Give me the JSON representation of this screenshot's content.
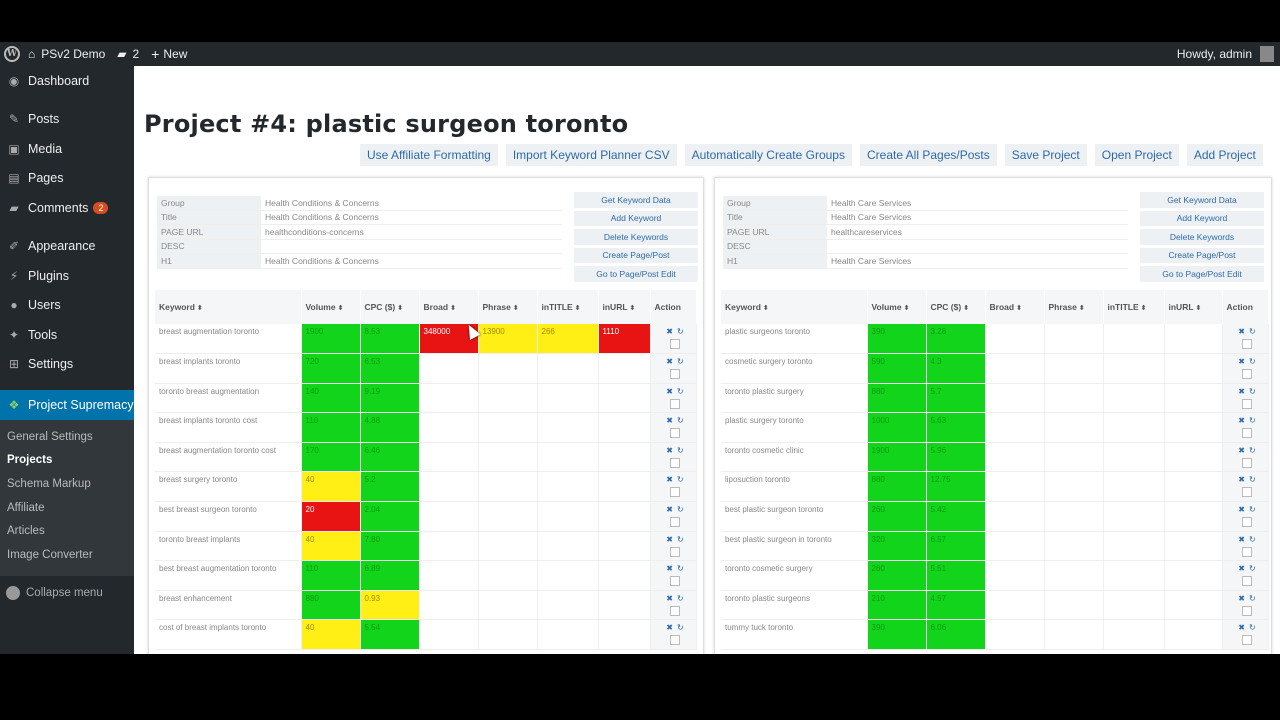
{
  "adminbar": {
    "site_name": "PSv2 Demo",
    "comments_count": "2",
    "new_label": "New",
    "howdy": "Howdy, admin"
  },
  "sidebar": {
    "items": [
      {
        "label": "Dashboard",
        "icon": "dashboard-icon"
      },
      {
        "label": "Posts",
        "icon": "pin-icon"
      },
      {
        "label": "Media",
        "icon": "media-icon"
      },
      {
        "label": "Pages",
        "icon": "pages-icon"
      },
      {
        "label": "Comments",
        "icon": "comment-icon",
        "badge": "2"
      },
      {
        "label": "Appearance",
        "icon": "brush-icon"
      },
      {
        "label": "Plugins",
        "icon": "plug-icon"
      },
      {
        "label": "Users",
        "icon": "user-icon"
      },
      {
        "label": "Tools",
        "icon": "wrench-icon"
      },
      {
        "label": "Settings",
        "icon": "settings-icon"
      },
      {
        "label": "Project Supremacy",
        "icon": "leaf-icon"
      }
    ],
    "submenu": [
      "General Settings",
      "Projects",
      "Schema Markup",
      "Affiliate",
      "Articles",
      "Image Converter"
    ],
    "collapse_label": "Collapse menu"
  },
  "page_title": "Project #4: plastic surgeon toronto",
  "toolbar": [
    "Use Affiliate Formatting",
    "Import Keyword Planner CSV",
    "Automatically Create Groups",
    "Create All Pages/Posts",
    "Save Project",
    "Open Project",
    "Add Project"
  ],
  "panel_actions": [
    "Get Keyword Data",
    "Add Keyword",
    "Delete Keywords",
    "Create Page/Post",
    "Go to Page/Post Edit"
  ],
  "columns": [
    "Keyword",
    "Volume",
    "CPC ($)",
    "Broad",
    "Phrase",
    "inTITLE",
    "inURL",
    "Action"
  ],
  "colors": {
    "green": "#12d41a",
    "yellow": "#ffef14",
    "red": "#e81313",
    "sidebar": "#23282d",
    "active": "#0073aa"
  },
  "groups": [
    {
      "meta": [
        {
          "key": "Group",
          "value": "Health Conditions & Concerns"
        },
        {
          "key": "Title",
          "value": "Health Conditions & Concerns"
        },
        {
          "key": "PAGE URL",
          "value": "healthconditions-concerns"
        },
        {
          "key": "DESC",
          "value": ""
        },
        {
          "key": "H1",
          "value": "Health Conditions & Concerns"
        }
      ],
      "rows": [
        {
          "keyword": "breast augmentation toronto",
          "volume": {
            "v": "1900",
            "c": "g"
          },
          "cpc": {
            "v": "8.53",
            "c": "g"
          },
          "broad": {
            "v": "348000",
            "c": "r"
          },
          "phrase": {
            "v": "13900",
            "c": "y"
          },
          "intitle": {
            "v": "266",
            "c": "y"
          },
          "inurl": {
            "v": "1110",
            "c": "r"
          }
        },
        {
          "keyword": "breast implants toronto",
          "volume": {
            "v": "720",
            "c": "g"
          },
          "cpc": {
            "v": "6.53",
            "c": "g"
          }
        },
        {
          "keyword": "toronto breast augmentation",
          "volume": {
            "v": "140",
            "c": "g"
          },
          "cpc": {
            "v": "9.19",
            "c": "g"
          }
        },
        {
          "keyword": "breast implants toronto cost",
          "volume": {
            "v": "110",
            "c": "g"
          },
          "cpc": {
            "v": "4.88",
            "c": "g"
          }
        },
        {
          "keyword": "breast augmentation toronto cost",
          "volume": {
            "v": "170",
            "c": "g"
          },
          "cpc": {
            "v": "6.46",
            "c": "g"
          }
        },
        {
          "keyword": "breast surgery toronto",
          "volume": {
            "v": "40",
            "c": "y"
          },
          "cpc": {
            "v": "5.2",
            "c": "g"
          }
        },
        {
          "keyword": "best breast surgeon toronto",
          "volume": {
            "v": "20",
            "c": "r"
          },
          "cpc": {
            "v": "2.04",
            "c": "g"
          }
        },
        {
          "keyword": "toronto breast implants",
          "volume": {
            "v": "40",
            "c": "y"
          },
          "cpc": {
            "v": "7.80",
            "c": "g"
          }
        },
        {
          "keyword": "best breast augmentation toronto",
          "volume": {
            "v": "110",
            "c": "g"
          },
          "cpc": {
            "v": "6.89",
            "c": "g"
          }
        },
        {
          "keyword": "breast enhancement",
          "volume": {
            "v": "880",
            "c": "g"
          },
          "cpc": {
            "v": "0.93",
            "c": "y"
          }
        },
        {
          "keyword": "cost of breast implants toronto",
          "volume": {
            "v": "40",
            "c": "y"
          },
          "cpc": {
            "v": "5.54",
            "c": "g"
          }
        }
      ]
    },
    {
      "meta": [
        {
          "key": "Group",
          "value": "Health Care Services"
        },
        {
          "key": "Title",
          "value": "Health Care Services"
        },
        {
          "key": "PAGE URL",
          "value": "healthcareservices"
        },
        {
          "key": "DESC",
          "value": ""
        },
        {
          "key": "H1",
          "value": "Health Care Services"
        }
      ],
      "rows": [
        {
          "keyword": "plastic surgeons toronto",
          "volume": {
            "v": "390",
            "c": "g"
          },
          "cpc": {
            "v": "3.28",
            "c": "g"
          }
        },
        {
          "keyword": "cosmetic surgery toronto",
          "volume": {
            "v": "590",
            "c": "g"
          },
          "cpc": {
            "v": "4.3",
            "c": "g"
          }
        },
        {
          "keyword": "toronto plastic surgery",
          "volume": {
            "v": "880",
            "c": "g"
          },
          "cpc": {
            "v": "5.7",
            "c": "g"
          }
        },
        {
          "keyword": "plastic surgery toronto",
          "volume": {
            "v": "1000",
            "c": "g"
          },
          "cpc": {
            "v": "5.63",
            "c": "g"
          }
        },
        {
          "keyword": "toronto cosmetic clinic",
          "volume": {
            "v": "1900",
            "c": "g"
          },
          "cpc": {
            "v": "5.96",
            "c": "g"
          }
        },
        {
          "keyword": "liposuction toronto",
          "volume": {
            "v": "880",
            "c": "g"
          },
          "cpc": {
            "v": "12.75",
            "c": "g"
          }
        },
        {
          "keyword": "best plastic surgeon toronto",
          "volume": {
            "v": "260",
            "c": "g"
          },
          "cpc": {
            "v": "5.42",
            "c": "g"
          }
        },
        {
          "keyword": "best plastic surgeon in toronto",
          "volume": {
            "v": "320",
            "c": "g"
          },
          "cpc": {
            "v": "6.57",
            "c": "g"
          }
        },
        {
          "keyword": "toronto cosmetic surgery",
          "volume": {
            "v": "260",
            "c": "g"
          },
          "cpc": {
            "v": "5.51",
            "c": "g"
          }
        },
        {
          "keyword": "toronto plastic surgeons",
          "volume": {
            "v": "210",
            "c": "g"
          },
          "cpc": {
            "v": "4.57",
            "c": "g"
          }
        },
        {
          "keyword": "tummy tuck toronto",
          "volume": {
            "v": "390",
            "c": "g"
          },
          "cpc": {
            "v": "6.06",
            "c": "g"
          }
        }
      ]
    }
  ]
}
